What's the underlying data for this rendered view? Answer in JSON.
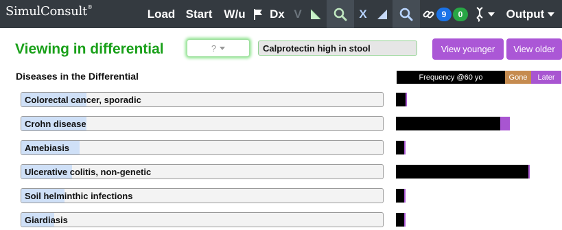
{
  "header": {
    "logo": "SimulConsult",
    "logo_tm": "®",
    "load_label": "Load",
    "start_label": "Start",
    "wu_label": "W/u",
    "dx_label": "Dx",
    "v_label": "V",
    "x_label": "X",
    "badge_blue": "9",
    "badge_green": "0",
    "output_label": "Output"
  },
  "main": {
    "title": "Viewing in differential",
    "question_select": "?",
    "finding": "Calprotectin high in stool",
    "view_younger_label": "View younger",
    "view_older_label": "View older"
  },
  "differential": {
    "heading": "Diseases in the Differential",
    "legend": {
      "frequency": "Frequency @60 yo",
      "gone": "Gone",
      "later": "Later"
    },
    "colors": {
      "frequency": "#000000",
      "gone": "#c58b4f",
      "later": "#a855d1",
      "probability_fill": "#cfe0f7"
    },
    "diseases": [
      {
        "name": "Colorectal cancer, sporadic",
        "probability": 0.18,
        "frequency": 0.06,
        "later": 0.0
      },
      {
        "name": "Crohn disease",
        "probability": 0.18,
        "frequency": 0.63,
        "later": 0.06
      },
      {
        "name": "Amebiasis",
        "probability": 0.16,
        "frequency": 0.05,
        "later": 0.0
      },
      {
        "name": "Ulcerative colitis, non-genetic",
        "probability": 0.14,
        "frequency": 0.8,
        "later": 0.0
      },
      {
        "name": "Soil helminthic infections",
        "probability": 0.12,
        "frequency": 0.05,
        "later": 0.0
      },
      {
        "name": "Giardiasis",
        "probability": 0.09,
        "frequency": 0.05,
        "later": 0.0
      }
    ]
  }
}
